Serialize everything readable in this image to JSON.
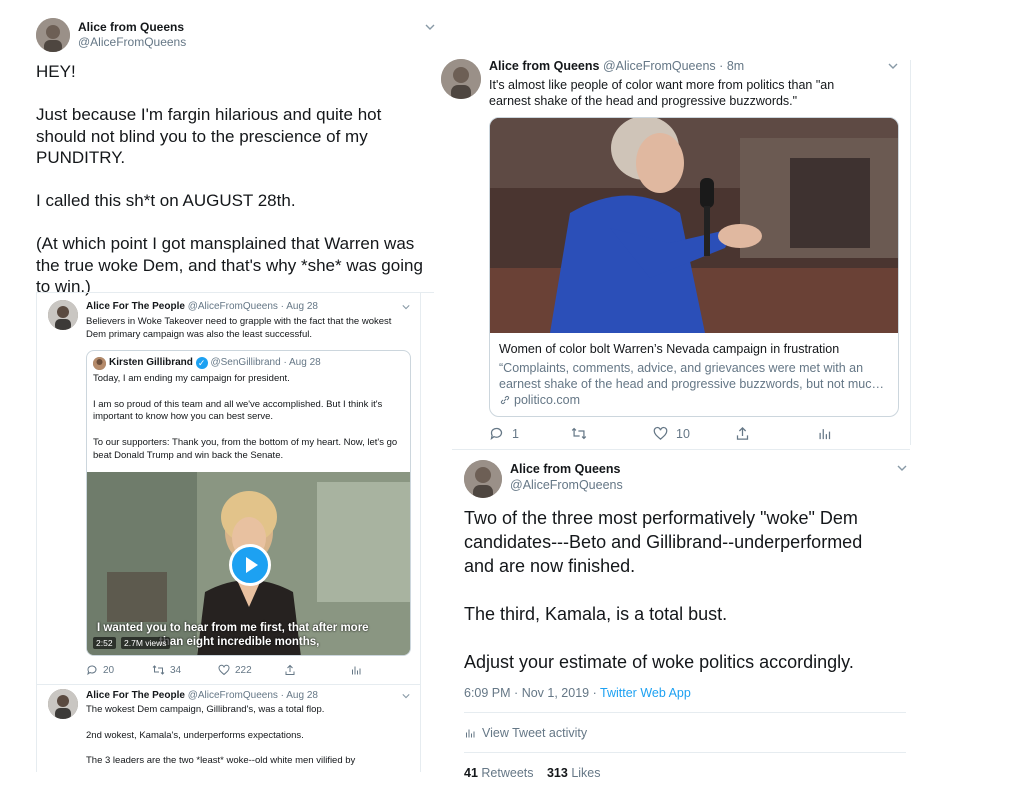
{
  "main_tweet": {
    "name": "Alice from Queens",
    "handle": "@AliceFromQueens",
    "text": "HEY!\n\nJust because I'm fargin hilarious and quite hot should not blind you to the prescience of my PUNDITRY.\n\nI called this sh*t on AUGUST 28th.\n\n(At which point I got mansplained that Warren was the true woke Dem, and that's why *she* was going to win.)"
  },
  "quoted_thread": {
    "tweet1": {
      "name": "Alice For The People",
      "handle": "@AliceFromQueens",
      "sep": "·",
      "date": "Aug 28",
      "text": "Believers in  Woke Takeover need to grapple with the fact that the wokest Dem primary campaign was also the least successful."
    },
    "inner_quote": {
      "name": "Kirsten Gillibrand",
      "verified_mark": "✓",
      "handle": "@SenGillibrand",
      "sep": "·",
      "date": "Aug 28",
      "text": "Today, I am ending my campaign for president.\n\nI am so proud of this team and all we've accomplished. But I think it's important to know how you can best serve.\n\nTo our supporters: Thank you, from the bottom of my heart. Now, let's go beat Donald Trump and win back the Senate.",
      "caption_line1": "I wanted you to hear from me first, that after more",
      "caption_line2": "than eight incredible months,",
      "duration": "2:52",
      "views": "2.7M views"
    },
    "tweet1_actions": {
      "replies": "20",
      "retweets": "34",
      "likes": "222"
    },
    "tweet2": {
      "name": "Alice For The People",
      "handle": "@AliceFromQueens",
      "sep": "·",
      "date": "Aug 28",
      "text": "The wokest Dem campaign, Gillibrand's, was a total flop.\n\n2nd wokest, Kamala's, underperforms expectations.\n\nThe 3 leaders are the two *least* woke--old white men vilified by"
    }
  },
  "top_right_tweet": {
    "name": "Alice from Queens",
    "handle": "@AliceFromQueens",
    "sep": "·",
    "time": "8m",
    "text": "It's almost like people of color want more from politics than    \"an earnest shake of the head and progressive  buzzwords.\"",
    "card": {
      "title": "Women of color bolt Warren’s Nevada campaign in frustration",
      "description": "“Complaints, comments, advice, and grievances were met with an earnest shake of the head and progressive buzzwords, but not muc…",
      "domain": "politico.com"
    },
    "actions": {
      "replies": "1",
      "retweets": "",
      "likes": "10"
    }
  },
  "bottom_right_tweet": {
    "name": "Alice from Queens",
    "handle": "@AliceFromQueens",
    "text": "Two of the three most performatively \"woke\" Dem candidates---Beto and Gillibrand--underperformed and are now finished.\n\nThe third, Kamala, is a total bust.\n\nAdjust your estimate of woke politics accordingly.",
    "time": "6:09 PM",
    "sep1": "·",
    "date": "Nov 1, 2019",
    "sep2": "·",
    "app": "Twitter Web App",
    "activity_label": "View Tweet activity",
    "retweets_count": "41",
    "retweets_label": "Retweets",
    "likes_count": "313",
    "likes_label": "Likes"
  },
  "colors": {
    "link": "#1da1f2",
    "muted": "#657786",
    "text": "#14171a",
    "border": "#e1e8ed"
  }
}
